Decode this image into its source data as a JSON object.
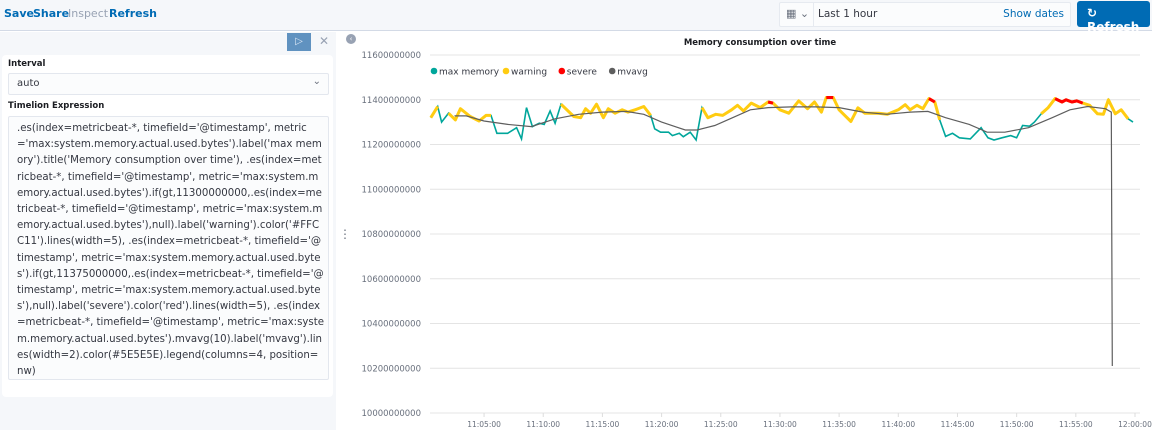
{
  "topnav": {
    "save": "Save",
    "share": "Share",
    "inspect": "Inspect",
    "refresh": "Refresh"
  },
  "datepicker": {
    "icon": "calendar-icon",
    "value": "Last 1 hour",
    "show_dates": "Show dates"
  },
  "refresh_button": {
    "label": "Refresh",
    "icon": "refresh-icon"
  },
  "editor": {
    "run_icon": "play-icon",
    "close_icon": "close-icon",
    "interval_label": "Interval",
    "interval_value": "auto",
    "expression_label": "Timelion Expression",
    "expression": ".es(index=metricbeat-*, timefield='@timestamp', metric='max:system.memory.actual.used.bytes').label('max memory').title('Memory consumption over time'), .es(index=metricbeat-*, timefield='@timestamp', metric='max:system.memory.actual.used.bytes').if(gt,11300000000,.es(index=metricbeat-*, timefield='@timestamp', metric='max:system.memory.actual.used.bytes'),null).label('warning').color('#FFCC11').lines(width=5), .es(index=metricbeat-*, timefield='@timestamp', metric='max:system.memory.actual.used.bytes').if(gt,11375000000,.es(index=metricbeat-*, timefield='@timestamp', metric='max:system.memory.actual.used.bytes'),null).label('severe').color('red').lines(width=5), .es(index=metricbeat-*, timefield='@timestamp', metric='max:system.memory.actual.used.bytes').mvavg(10).label('mvavg').lines(width=2).color(#5E5E5E).legend(columns=4, position=nw)"
  },
  "chart_data": {
    "type": "line",
    "title": "Memory consumption over time",
    "legend_position": "top-left",
    "grid": true,
    "xlim": [
      "11:00:26",
      "12:00:00"
    ],
    "ylim": [
      10000000000,
      11600000000
    ],
    "yticks": [
      "10000000000",
      "10200000000",
      "10400000000",
      "10600000000",
      "10800000000",
      "11000000000",
      "11200000000",
      "11400000000",
      "11600000000"
    ],
    "xticks": [
      "11:05:00",
      "11:10:00",
      "11:15:00",
      "11:20:00",
      "11:25:00",
      "11:30:00",
      "11:35:00",
      "11:40:00",
      "11:45:00",
      "11:50:00",
      "11:55:00",
      "12:00:00"
    ],
    "thresholds": {
      "warning": 11300000000,
      "severe": 11375000000
    },
    "series": [
      {
        "name": "max memory",
        "color": "#00A69B",
        "points": [
          [
            "11:00:30",
            11320
          ],
          [
            "11:01:05",
            11370
          ],
          [
            "11:01:25",
            11300
          ],
          [
            "11:02:00",
            11340
          ],
          [
            "11:02:35",
            11310
          ],
          [
            "11:03:00",
            11360
          ],
          [
            "11:03:50",
            11325
          ],
          [
            "11:04:35",
            11305
          ],
          [
            "11:05:10",
            11330
          ],
          [
            "11:05:35",
            11330
          ],
          [
            "11:06:05",
            11250
          ],
          [
            "11:07:00",
            11250
          ],
          [
            "11:07:45",
            11275
          ],
          [
            "11:08:10",
            11225
          ],
          [
            "11:08:35",
            11365
          ],
          [
            "11:09:05",
            11280
          ],
          [
            "11:09:40",
            11295
          ],
          [
            "11:10:05",
            11290
          ],
          [
            "11:10:35",
            11350
          ],
          [
            "11:11:00",
            11295
          ],
          [
            "11:11:30",
            11380
          ],
          [
            "11:12:35",
            11325
          ],
          [
            "11:13:10",
            11320
          ],
          [
            "11:13:35",
            11360
          ],
          [
            "11:14:00",
            11340
          ],
          [
            "11:14:30",
            11380
          ],
          [
            "11:15:05",
            11320
          ],
          [
            "11:15:30",
            11360
          ],
          [
            "11:16:05",
            11340
          ],
          [
            "11:16:40",
            11355
          ],
          [
            "11:17:10",
            11345
          ],
          [
            "11:17:45",
            11355
          ],
          [
            "11:18:30",
            11370
          ],
          [
            "11:19:05",
            11330
          ],
          [
            "11:19:25",
            11270
          ],
          [
            "11:19:55",
            11255
          ],
          [
            "11:20:35",
            11255
          ],
          [
            "11:20:55",
            11240
          ],
          [
            "11:21:30",
            11250
          ],
          [
            "11:21:50",
            11235
          ],
          [
            "11:22:25",
            11255
          ],
          [
            "11:22:55",
            11220
          ],
          [
            "11:23:25",
            11365
          ],
          [
            "11:23:55",
            11320
          ],
          [
            "11:24:35",
            11335
          ],
          [
            "11:25:10",
            11330
          ],
          [
            "11:25:55",
            11355
          ],
          [
            "11:26:25",
            11375
          ],
          [
            "11:26:55",
            11350
          ],
          [
            "11:27:35",
            11385
          ],
          [
            "11:28:20",
            11365
          ],
          [
            "11:29:00",
            11390
          ],
          [
            "11:29:25",
            11385
          ],
          [
            "11:30:00",
            11355
          ],
          [
            "11:30:45",
            11340
          ],
          [
            "11:31:35",
            11395
          ],
          [
            "11:32:20",
            11360
          ],
          [
            "11:32:55",
            11390
          ],
          [
            "11:33:30",
            11345
          ],
          [
            "11:33:55",
            11410
          ],
          [
            "11:34:30",
            11410
          ],
          [
            "11:35:00",
            11355
          ],
          [
            "11:36:00",
            11303
          ],
          [
            "11:36:35",
            11364
          ],
          [
            "11:37:10",
            11340
          ],
          [
            "11:38:20",
            11340
          ],
          [
            "11:39:05",
            11335
          ],
          [
            "11:40:00",
            11355
          ],
          [
            "11:40:35",
            11378
          ],
          [
            "11:41:00",
            11355
          ],
          [
            "11:41:35",
            11375
          ],
          [
            "11:42:05",
            11360
          ],
          [
            "11:42:35",
            11405
          ],
          [
            "11:43:05",
            11390
          ],
          [
            "11:43:30",
            11310
          ],
          [
            "11:44:00",
            11236
          ],
          [
            "11:44:35",
            11250
          ],
          [
            "11:45:10",
            11230
          ],
          [
            "11:46:05",
            11225
          ],
          [
            "11:47:00",
            11275
          ],
          [
            "11:47:35",
            11230
          ],
          [
            "11:48:05",
            11220
          ],
          [
            "11:48:45",
            11230
          ],
          [
            "11:49:30",
            11240
          ],
          [
            "11:50:00",
            11230
          ],
          [
            "11:50:30",
            11285
          ],
          [
            "11:51:05",
            11282
          ],
          [
            "11:51:30",
            11300
          ],
          [
            "11:52:05",
            11337
          ],
          [
            "11:52:40",
            11365
          ],
          [
            "11:53:15",
            11405
          ],
          [
            "11:53:50",
            11390
          ],
          [
            "11:54:10",
            11400
          ],
          [
            "11:54:40",
            11390
          ],
          [
            "11:55:05",
            11395
          ],
          [
            "11:55:35",
            11385
          ],
          [
            "11:56:10",
            11375
          ],
          [
            "11:56:50",
            11337
          ],
          [
            "11:57:20",
            11335
          ],
          [
            "11:57:45",
            11400
          ],
          [
            "11:58:20",
            11337
          ],
          [
            "11:58:50",
            11355
          ],
          [
            "11:59:25",
            11315
          ],
          [
            "11:59:50",
            11300
          ]
        ]
      },
      {
        "name": "warning",
        "color": "#FFCC11"
      },
      {
        "name": "severe",
        "color": "#FF0000"
      },
      {
        "name": "mvavg",
        "color": "#5E5E5E",
        "points": [
          [
            "11:02:30",
            11328
          ],
          [
            "11:03:30",
            11328
          ],
          [
            "11:05:00",
            11305
          ],
          [
            "11:07:00",
            11290
          ],
          [
            "11:09:00",
            11280
          ],
          [
            "11:11:00",
            11315
          ],
          [
            "11:13:00",
            11335
          ],
          [
            "11:15:00",
            11345
          ],
          [
            "11:17:00",
            11348
          ],
          [
            "11:18:30",
            11335
          ],
          [
            "11:20:00",
            11300
          ],
          [
            "11:22:00",
            11265
          ],
          [
            "11:23:00",
            11265
          ],
          [
            "11:24:30",
            11285
          ],
          [
            "11:26:00",
            11320
          ],
          [
            "11:27:30",
            11355
          ],
          [
            "11:29:00",
            11365
          ],
          [
            "11:31:00",
            11368
          ],
          [
            "11:33:00",
            11368
          ],
          [
            "11:35:00",
            11365
          ],
          [
            "11:37:00",
            11345
          ],
          [
            "11:39:00",
            11335
          ],
          [
            "11:41:00",
            11345
          ],
          [
            "11:42:30",
            11348
          ],
          [
            "11:44:00",
            11320
          ],
          [
            "11:46:00",
            11290
          ],
          [
            "11:47:30",
            11255
          ],
          [
            "11:49:00",
            11255
          ],
          [
            "11:51:00",
            11275
          ],
          [
            "11:53:00",
            11320
          ],
          [
            "11:54:30",
            11355
          ],
          [
            "11:56:00",
            11370
          ],
          [
            "11:57:30",
            11360
          ],
          [
            "11:58:00",
            11345
          ],
          [
            "11:58:05",
            10210
          ]
        ]
      }
    ],
    "value_unit_note_million_offset": true
  }
}
